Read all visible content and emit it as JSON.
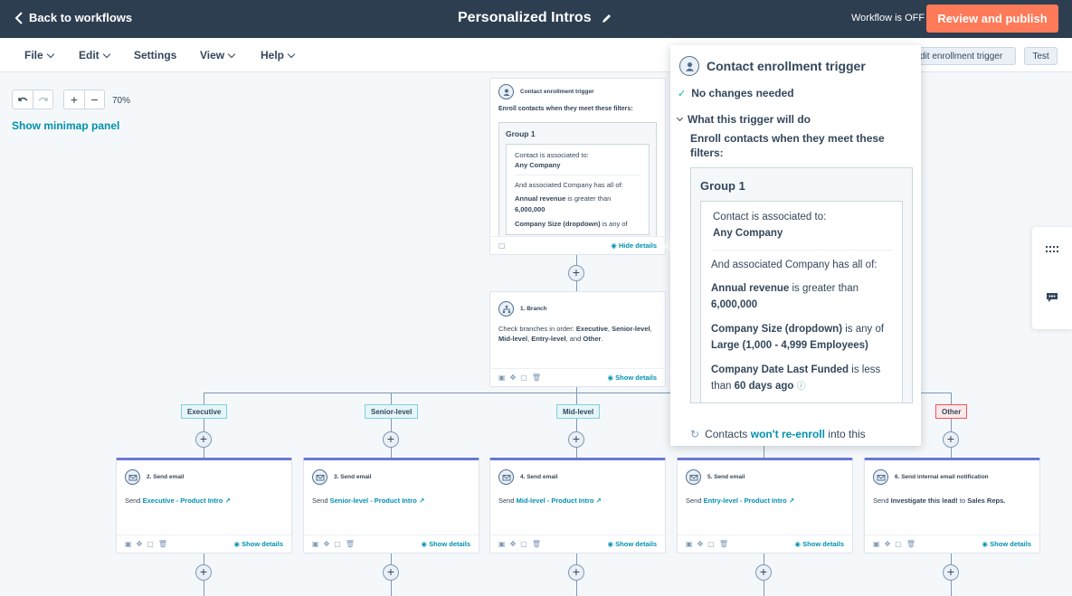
{
  "topbar": {
    "back_label": "Back to workflows",
    "title": "Personalized Intros",
    "status": "Workflow is OFF",
    "publish_label": "Review and publish"
  },
  "menu": {
    "items": [
      "File",
      "Edit",
      "Settings",
      "View",
      "Help"
    ],
    "edit_trigger_label": "dit enrollment trigger",
    "test_label": "Test"
  },
  "canvas": {
    "zoom": "70%",
    "minimap_label": "Show minimap panel"
  },
  "trigger_card": {
    "title": "Contact enrollment trigger",
    "intro": "Enroll contacts when they meet these filters:",
    "group_title": "Group 1",
    "assoc_text": "Contact is associated to:",
    "assoc_value": "Any Company",
    "and_text": "And associated Company has all of:",
    "f1_name": "Annual revenue",
    "f1_op": " is greater than ",
    "f1_value": "6,000,000",
    "f2_name": "Company Size (dropdown)",
    "f2_op": " is any of",
    "hide_label": "Hide details"
  },
  "branch_card": {
    "title": "1. Branch",
    "text_prefix": "Check branches in order: ",
    "b1": "Executive",
    "b2": "Senior-level",
    "b3": "Mid-level",
    "b4": "Entry-level",
    "and_text": "and",
    "b5": "Other",
    "show_label": "Show details"
  },
  "branches": [
    "Executive",
    "Senior-level",
    "Mid-level",
    "Other"
  ],
  "actions": [
    {
      "title": "2. Send email",
      "verb": "Send ",
      "link": "Executive - Product Intro",
      "show": "Show details"
    },
    {
      "title": "3. Send email",
      "verb": "Send ",
      "link": "Senior-level - Product Intro",
      "show": "Show details"
    },
    {
      "title": "4. Send email",
      "verb": "Send ",
      "link": "Mid-level - Product Intro",
      "show": "Show details"
    },
    {
      "title": "5. Send email",
      "verb": "Send ",
      "link": "Entry-level - Product Intro",
      "show": "Show details"
    },
    {
      "title": "6. Send internal email notification",
      "verb": "Send ",
      "link": "Investigate this lead!",
      "suffix": " to ",
      "target": "Sales Reps.",
      "show": "Show details"
    }
  ],
  "panel": {
    "title": "Contact enrollment trigger",
    "no_changes": "No changes needed",
    "what_trigger": "What this trigger will do",
    "enroll_text": "Enroll contacts when they meet these filters:",
    "group_title": "Group 1",
    "assoc_text": "Contact is associated to:",
    "assoc_value": "Any Company",
    "and_text": "And associated Company has all of:",
    "f1_name": "Annual revenue",
    "f1_op": " is greater than ",
    "f1_value": "6,000,000",
    "f2_name": "Company Size (dropdown)",
    "f2_op": " is any of ",
    "f2_value": "Large (1,000 - 4,999 Employees)",
    "f3_name": "Company Date Last Funded",
    "f3_op": " is less than ",
    "f3_value": "60 days ago",
    "reenroll_prefix": "Contacts ",
    "reenroll_link": "won't re-enroll",
    "reenroll_suffix": " into this"
  },
  "colors": {
    "topbar": "#2d3e50",
    "accent": "#ff7a59",
    "link": "#0091ae",
    "email_border": "#6a78d1"
  }
}
